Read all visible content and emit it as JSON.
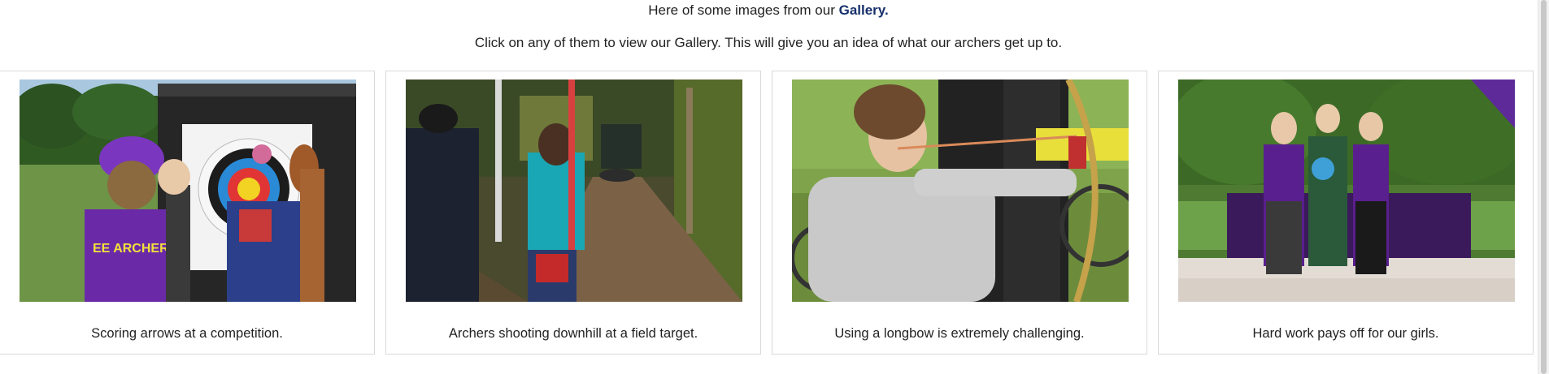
{
  "intro": {
    "line1_prefix": "Here of some images from our",
    "gallery_link": "Gallery.",
    "line2": "Click on any of them to view our Gallery. This will give you an idea of what our archers get up to."
  },
  "cards": [
    {
      "caption": "Scoring arrows at a competition.",
      "image": "archers-scoring-target-photo"
    },
    {
      "caption": "Archers shooting downhill at a field target.",
      "image": "archers-shooting-downhill-photo"
    },
    {
      "caption": "Using a longbow is extremely challenging.",
      "image": "longbow-archer-photo"
    },
    {
      "caption": "Hard work pays off for our girls.",
      "image": "girls-podium-awards-photo"
    }
  ],
  "photo_texts": {
    "shirt_text": "EE ARCHERS"
  },
  "colors": {
    "link": "#17306b",
    "card_border": "#d9d9d9",
    "purple": "#5b1f8e"
  }
}
